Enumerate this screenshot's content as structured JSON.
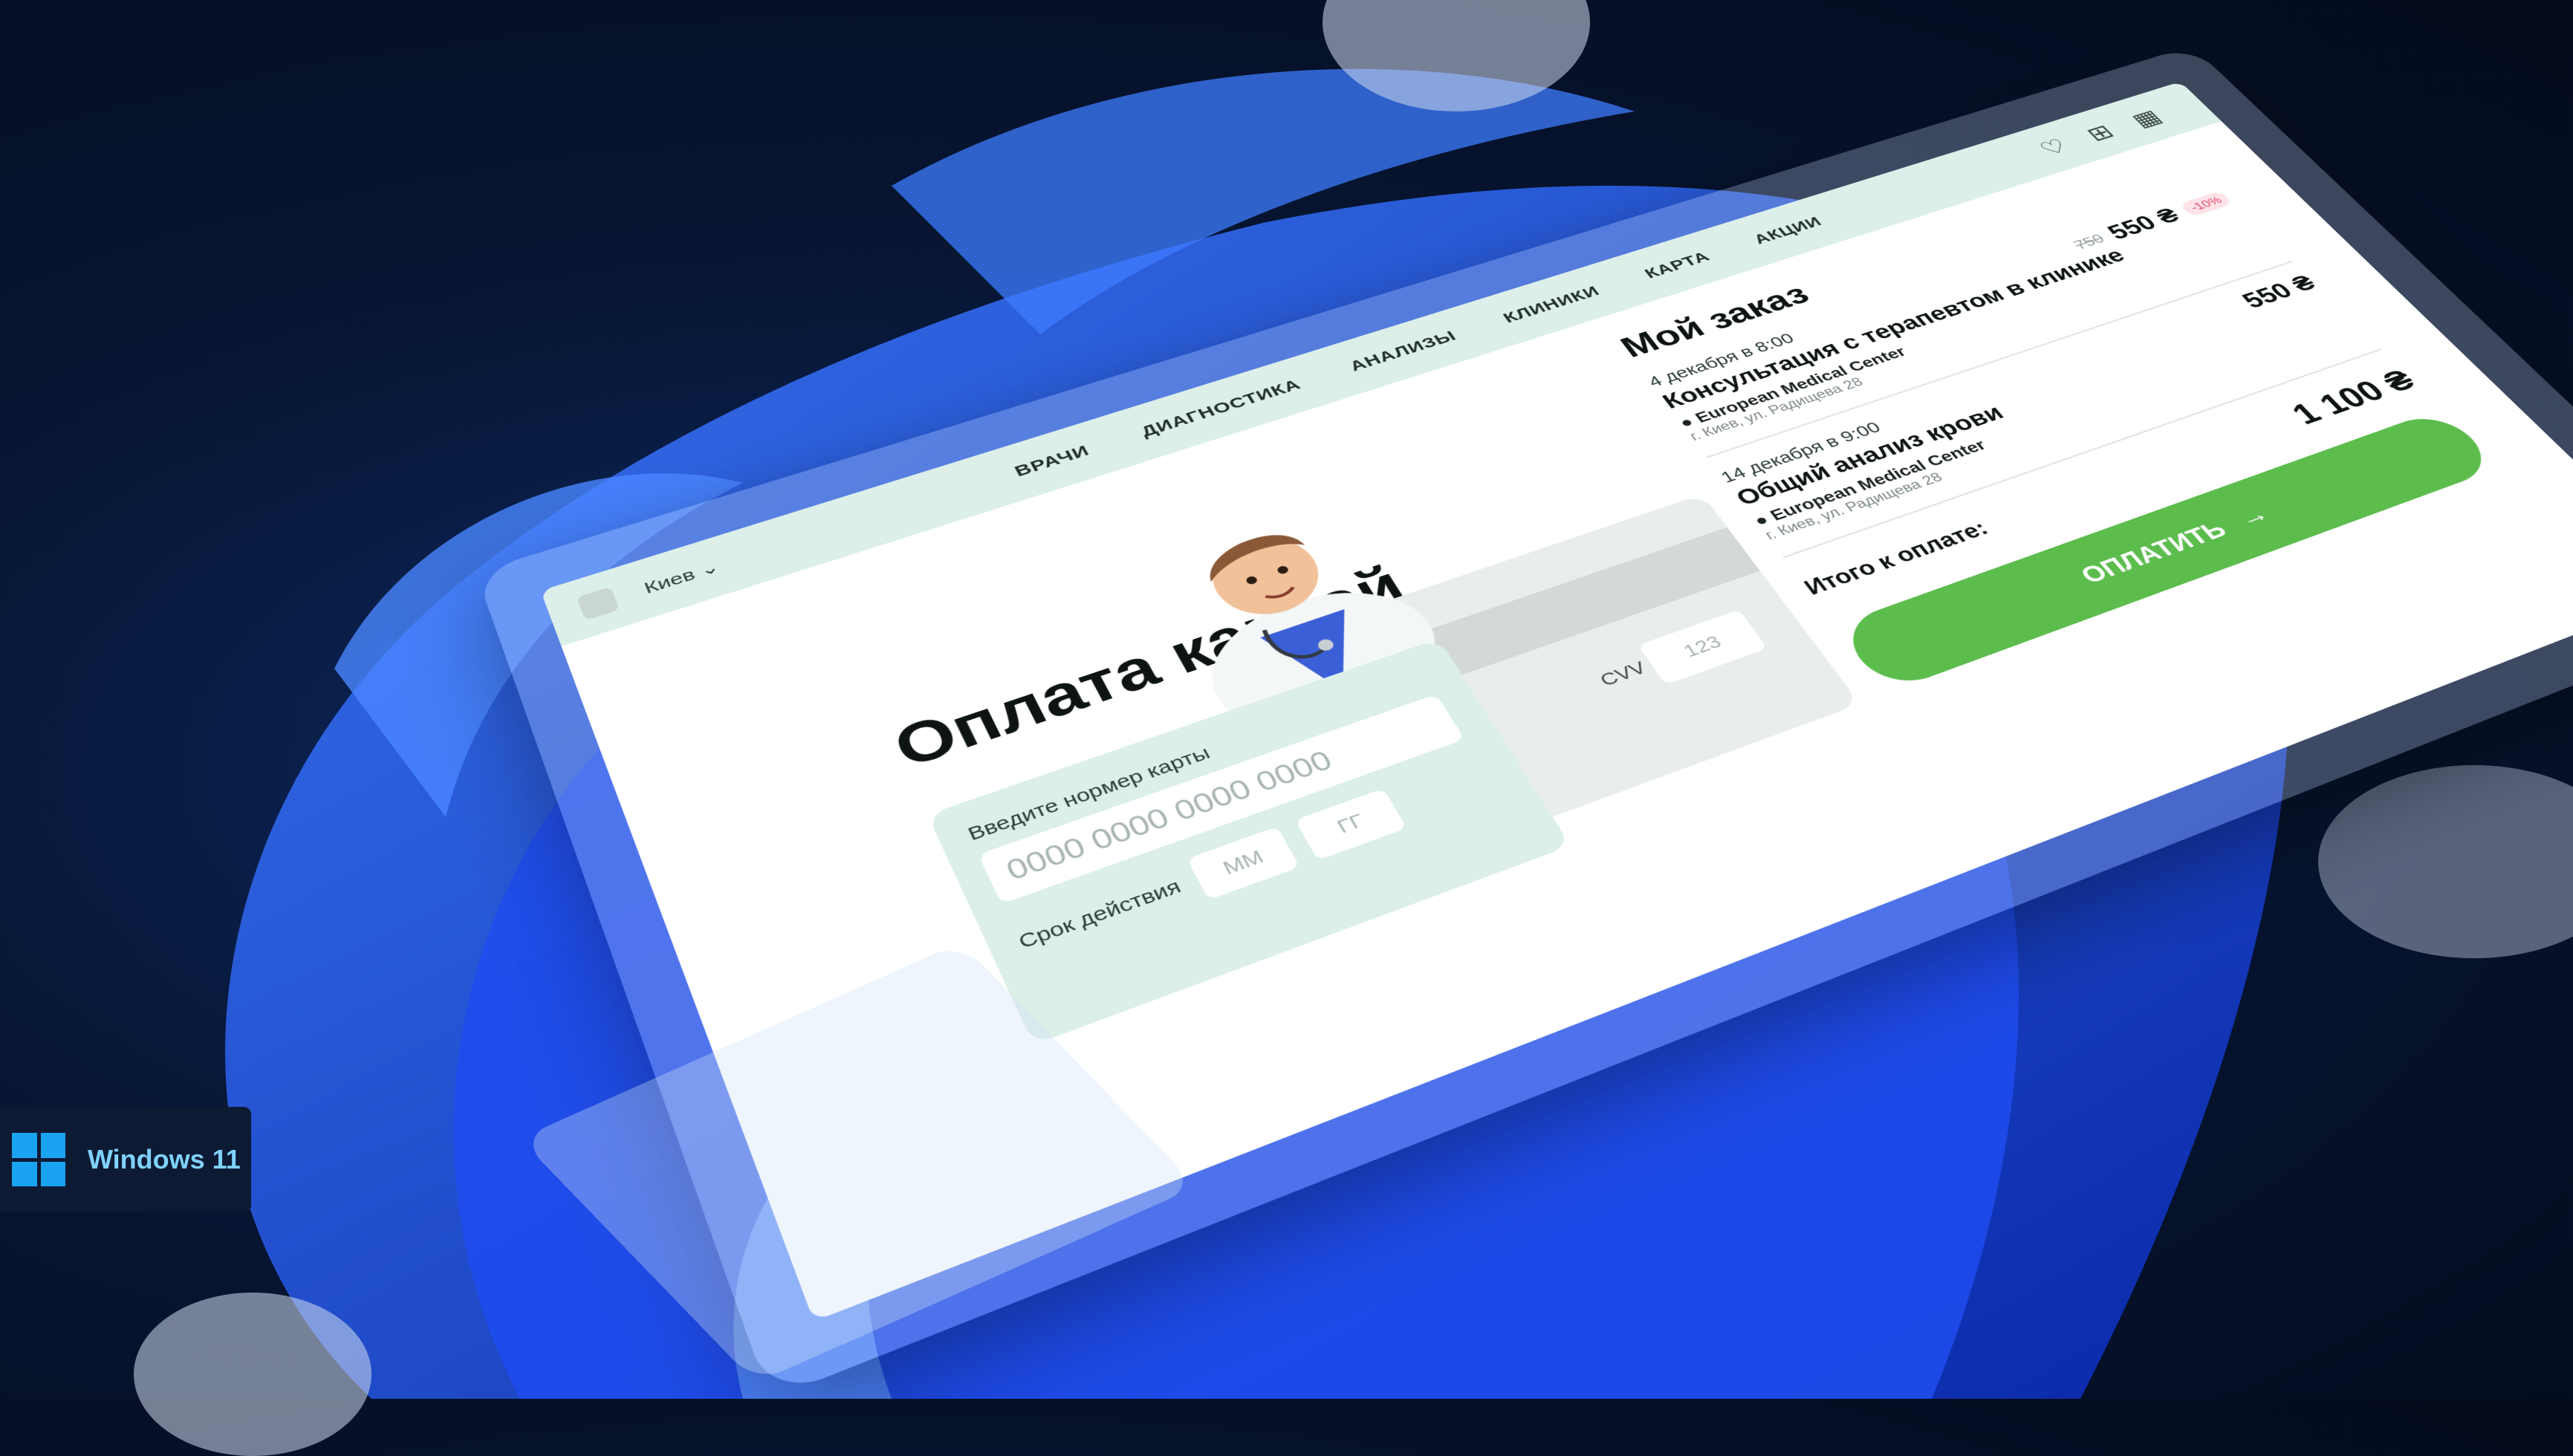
{
  "colors": {
    "accent": "#5cbd4d",
    "nav_bg": "#dcefe9",
    "badge_bg": "#0d1a33",
    "windows_blue": "#1aa3f0"
  },
  "nav": {
    "city": "Киев ⌄",
    "links": [
      "ВРАЧИ",
      "ДИАГНОСТИКА",
      "АНАЛИЗЫ",
      "КЛИНИКИ",
      "КАРТА",
      "АКЦИИ"
    ],
    "icons": [
      "heart-icon",
      "medical-case-icon",
      "calendar-icon"
    ]
  },
  "payment": {
    "title": "Оплата картой",
    "card_number_label": "Введите нормер карты",
    "card_number_placeholder": "0000 0000 0000 0000",
    "expiry_label": "Срок действия",
    "month_placeholder": "ММ",
    "year_placeholder": "ГГ",
    "cvv_label": "CVV",
    "cvv_placeholder": "123"
  },
  "order": {
    "title": "Мой заказ",
    "items": [
      {
        "date": "4 декабря в 8:00",
        "name": "Консультация с терапевтом в клинике",
        "place": "European Medical Center",
        "address": "г. Киев, ул. Радищева 28",
        "old_price": "750",
        "price": "550 ₴",
        "discount": "-10%"
      },
      {
        "date": "14 декабря в 9:00",
        "name": "Общий анализ крови",
        "place": "European Medical Center",
        "address": "г. Киев, ул. Радищева 28",
        "price": "550 ₴"
      }
    ],
    "total_label": "Итого к оплате:",
    "total_value": "1 100 ₴",
    "pay_button": "ОПЛАТИТЬ"
  },
  "badge": {
    "label": "Windows 11"
  }
}
